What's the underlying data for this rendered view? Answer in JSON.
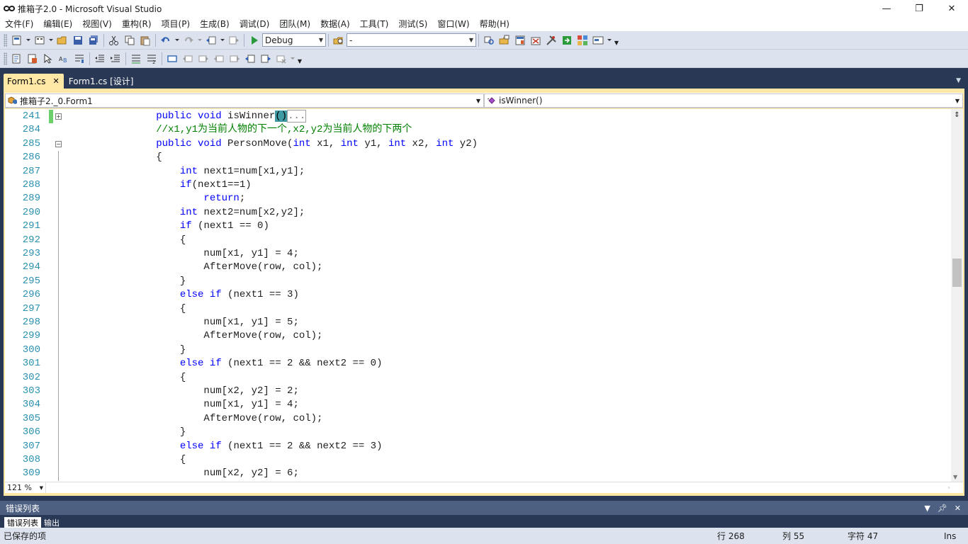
{
  "window": {
    "title": "推箱子2.0 - Microsoft Visual Studio",
    "minimize": "—",
    "restore": "❐",
    "close": "✕"
  },
  "menu": [
    "文件(F)",
    "编辑(E)",
    "视图(V)",
    "重构(R)",
    "项目(P)",
    "生成(B)",
    "调试(D)",
    "团队(M)",
    "数据(A)",
    "工具(T)",
    "测试(S)",
    "窗口(W)",
    "帮助(H)"
  ],
  "toolbar": {
    "config_value": "Debug",
    "platform_value": "-"
  },
  "tabs": [
    {
      "label": "Form1.cs",
      "close": "✕"
    },
    {
      "label": "Form1.cs [设计]"
    }
  ],
  "navbar": {
    "type_combo": "推箱子2._0.Form1",
    "member_combo": "isWinner()"
  },
  "code_lines": [
    {
      "num": "241",
      "parts": [
        [
          "",
          "        "
        ],
        [
          "kw",
          "public void"
        ],
        [
          "",
          " isWinner"
        ],
        [
          "hl",
          "()"
        ],
        [
          "collapsed",
          "..."
        ]
      ]
    },
    {
      "num": "284",
      "parts": [
        [
          "",
          "        "
        ],
        [
          "cm",
          "//x1,y1为当前人物的下一个,x2,y2为当前人物的下两个"
        ]
      ]
    },
    {
      "num": "285",
      "parts": [
        [
          "",
          "        "
        ],
        [
          "kw",
          "public void"
        ],
        [
          "",
          " PersonMove("
        ],
        [
          "kw",
          "int"
        ],
        [
          "",
          " x1, "
        ],
        [
          "kw",
          "int"
        ],
        [
          "",
          " y1, "
        ],
        [
          "kw",
          "int"
        ],
        [
          "",
          " x2, "
        ],
        [
          "kw",
          "int"
        ],
        [
          "",
          " y2)"
        ]
      ]
    },
    {
      "num": "286",
      "parts": [
        [
          "",
          "        {"
        ]
      ]
    },
    {
      "num": "287",
      "parts": [
        [
          "",
          "            "
        ],
        [
          "kw",
          "int"
        ],
        [
          "",
          " next1=num[x1,y1];"
        ]
      ]
    },
    {
      "num": "288",
      "parts": [
        [
          "",
          "            "
        ],
        [
          "kw",
          "if"
        ],
        [
          "",
          "(next1==1)"
        ]
      ]
    },
    {
      "num": "289",
      "parts": [
        [
          "",
          "                "
        ],
        [
          "kw",
          "return"
        ],
        [
          "",
          ";"
        ]
      ]
    },
    {
      "num": "290",
      "parts": [
        [
          "",
          "            "
        ],
        [
          "kw",
          "int"
        ],
        [
          "",
          " next2=num[x2,y2];"
        ]
      ]
    },
    {
      "num": "291",
      "parts": [
        [
          "",
          "            "
        ],
        [
          "kw",
          "if"
        ],
        [
          "",
          " (next1 == 0)"
        ]
      ]
    },
    {
      "num": "292",
      "parts": [
        [
          "",
          "            {"
        ]
      ]
    },
    {
      "num": "293",
      "parts": [
        [
          "",
          "                num[x1, y1] = 4;"
        ]
      ]
    },
    {
      "num": "294",
      "parts": [
        [
          "",
          "                AfterMove(row, col);"
        ]
      ]
    },
    {
      "num": "295",
      "parts": [
        [
          "",
          "            }"
        ]
      ]
    },
    {
      "num": "296",
      "parts": [
        [
          "",
          "            "
        ],
        [
          "kw",
          "else if"
        ],
        [
          "",
          " (next1 == 3)"
        ]
      ]
    },
    {
      "num": "297",
      "parts": [
        [
          "",
          "            {"
        ]
      ]
    },
    {
      "num": "298",
      "parts": [
        [
          "",
          "                num[x1, y1] = 5;"
        ]
      ]
    },
    {
      "num": "299",
      "parts": [
        [
          "",
          "                AfterMove(row, col);"
        ]
      ]
    },
    {
      "num": "300",
      "parts": [
        [
          "",
          "            }"
        ]
      ]
    },
    {
      "num": "301",
      "parts": [
        [
          "",
          "            "
        ],
        [
          "kw",
          "else if"
        ],
        [
          "",
          " (next1 == 2 && next2 == 0)"
        ]
      ]
    },
    {
      "num": "302",
      "parts": [
        [
          "",
          "            {"
        ]
      ]
    },
    {
      "num": "303",
      "parts": [
        [
          "",
          "                num[x2, y2] = 2;"
        ]
      ]
    },
    {
      "num": "304",
      "parts": [
        [
          "",
          "                num[x1, y1] = 4;"
        ]
      ]
    },
    {
      "num": "305",
      "parts": [
        [
          "",
          "                AfterMove(row, col);"
        ]
      ]
    },
    {
      "num": "306",
      "parts": [
        [
          "",
          "            }"
        ]
      ]
    },
    {
      "num": "307",
      "parts": [
        [
          "",
          "            "
        ],
        [
          "kw",
          "else if"
        ],
        [
          "",
          " (next1 == 2 && next2 == 3)"
        ]
      ]
    },
    {
      "num": "308",
      "parts": [
        [
          "",
          "            {"
        ]
      ]
    },
    {
      "num": "309",
      "parts": [
        [
          "",
          "                num[x2, y2] = 6;"
        ]
      ]
    }
  ],
  "zoom": "121 %",
  "error_panel": {
    "title": "错误列表",
    "tab1": "错误列表",
    "tab2": "输出"
  },
  "status": {
    "message": "已保存的项",
    "line": "行 268",
    "col": "列 55",
    "char": "字符 47",
    "mode": "Ins"
  },
  "colors": {
    "keyword": "#0000ff",
    "comment": "#008000",
    "line_number": "#2b91af",
    "active_tab": "#ffe8a6",
    "chrome": "#293955"
  }
}
